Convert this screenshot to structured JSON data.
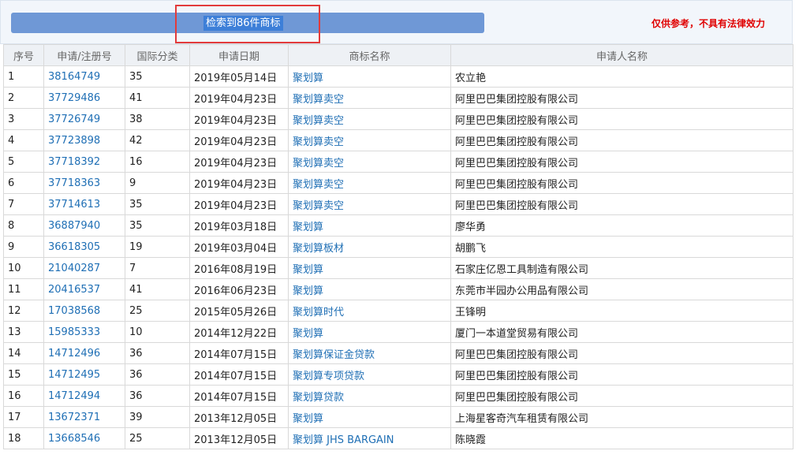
{
  "header": {
    "result_text": "检索到86件商标",
    "disclaimer": "仅供参考，不具有法律效力"
  },
  "table": {
    "columns": [
      "序号",
      "申请/注册号",
      "国际分类",
      "申请日期",
      "商标名称",
      "申请人名称"
    ],
    "rows": [
      [
        "1",
        "38164749",
        "35",
        "2019年05月14日",
        "聚划算",
        "农立艳"
      ],
      [
        "2",
        "37729486",
        "41",
        "2019年04月23日",
        "聚划算卖空",
        "阿里巴巴集团控股有限公司"
      ],
      [
        "3",
        "37726749",
        "38",
        "2019年04月23日",
        "聚划算卖空",
        "阿里巴巴集团控股有限公司"
      ],
      [
        "4",
        "37723898",
        "42",
        "2019年04月23日",
        "聚划算卖空",
        "阿里巴巴集团控股有限公司"
      ],
      [
        "5",
        "37718392",
        "16",
        "2019年04月23日",
        "聚划算卖空",
        "阿里巴巴集团控股有限公司"
      ],
      [
        "6",
        "37718363",
        "9",
        "2019年04月23日",
        "聚划算卖空",
        "阿里巴巴集团控股有限公司"
      ],
      [
        "7",
        "37714613",
        "35",
        "2019年04月23日",
        "聚划算卖空",
        "阿里巴巴集团控股有限公司"
      ],
      [
        "8",
        "36887940",
        "35",
        "2019年03月18日",
        "聚划算",
        "廖华勇"
      ],
      [
        "9",
        "36618305",
        "19",
        "2019年03月04日",
        "聚划算板材",
        "胡鹏飞"
      ],
      [
        "10",
        "21040287",
        "7",
        "2016年08月19日",
        "聚划算",
        "石家庄亿恩工具制造有限公司"
      ],
      [
        "11",
        "20416537",
        "41",
        "2016年06月23日",
        "聚划算",
        "东莞市半园办公用品有限公司"
      ],
      [
        "12",
        "17038568",
        "25",
        "2015年05月26日",
        "聚划算时代",
        "王锋明"
      ],
      [
        "13",
        "15985333",
        "10",
        "2014年12月22日",
        "聚划算",
        "厦门一本道堂贸易有限公司"
      ],
      [
        "14",
        "14712496",
        "36",
        "2014年07月15日",
        "聚划算保证金贷款",
        "阿里巴巴集团控股有限公司"
      ],
      [
        "15",
        "14712495",
        "36",
        "2014年07月15日",
        "聚划算专项贷款",
        "阿里巴巴集团控股有限公司"
      ],
      [
        "16",
        "14712494",
        "36",
        "2014年07月15日",
        "聚划算贷款",
        "阿里巴巴集团控股有限公司"
      ],
      [
        "17",
        "13672371",
        "39",
        "2013年12月05日",
        "聚划算",
        "上海星客奇汽车租赁有限公司"
      ],
      [
        "18",
        "13668546",
        "25",
        "2013年12月05日",
        "聚划算 JHS BARGAIN",
        "陈晓霞"
      ]
    ]
  }
}
